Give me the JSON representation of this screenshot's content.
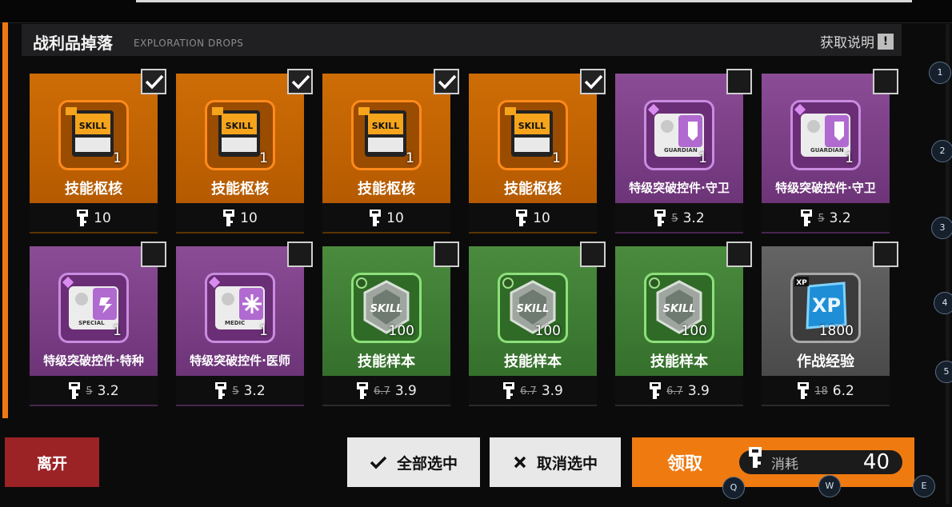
{
  "header": {
    "title": "战利品掉落",
    "subtitle": "EXPLORATION DROPS",
    "help_label": "获取说明",
    "help_icon": "!"
  },
  "items": [
    {
      "name": "技能枢核",
      "qty": "1",
      "cost": "10",
      "old_cost": "",
      "rarity": "orange",
      "icon": "skill-core-icon",
      "checked": true
    },
    {
      "name": "技能枢核",
      "qty": "1",
      "cost": "10",
      "old_cost": "",
      "rarity": "orange",
      "icon": "skill-core-icon",
      "checked": true
    },
    {
      "name": "技能枢核",
      "qty": "1",
      "cost": "10",
      "old_cost": "",
      "rarity": "orange",
      "icon": "skill-core-icon",
      "checked": true
    },
    {
      "name": "技能枢核",
      "qty": "1",
      "cost": "10",
      "old_cost": "",
      "rarity": "orange",
      "icon": "skill-core-icon",
      "checked": true
    },
    {
      "name": "特级突破控件·守卫",
      "qty": "1",
      "cost": "3.2",
      "old_cost": "5",
      "rarity": "purple",
      "icon": "guardian-module-icon",
      "checked": false
    },
    {
      "name": "特级突破控件·守卫",
      "qty": "1",
      "cost": "3.2",
      "old_cost": "5",
      "rarity": "purple",
      "icon": "guardian-module-icon",
      "checked": false
    },
    {
      "name": "特级突破控件·特种",
      "qty": "1",
      "cost": "3.2",
      "old_cost": "5",
      "rarity": "purple",
      "icon": "special-module-icon",
      "checked": false
    },
    {
      "name": "特级突破控件·医师",
      "qty": "1",
      "cost": "3.2",
      "old_cost": "5",
      "rarity": "purple",
      "icon": "medic-module-icon",
      "checked": false
    },
    {
      "name": "技能样本",
      "qty": "100",
      "cost": "3.9",
      "old_cost": "6.7",
      "rarity": "green",
      "icon": "skill-sample-icon",
      "checked": false
    },
    {
      "name": "技能样本",
      "qty": "100",
      "cost": "3.9",
      "old_cost": "6.7",
      "rarity": "green",
      "icon": "skill-sample-icon",
      "checked": false
    },
    {
      "name": "技能样本",
      "qty": "100",
      "cost": "3.9",
      "old_cost": "6.7",
      "rarity": "green",
      "icon": "skill-sample-icon",
      "checked": false
    },
    {
      "name": "作战经验",
      "qty": "1800",
      "cost": "6.2",
      "old_cost": "18",
      "rarity": "gray",
      "icon": "xp-crystal-icon",
      "checked": false
    }
  ],
  "icon_texts": {
    "skill": "SKILL",
    "guardian": "GUARDIAN",
    "special": "SPECIAL",
    "medic": "MEDIC",
    "xp": "XP"
  },
  "buttons": {
    "leave": "离开",
    "select_all": "全部选中",
    "deselect": "取消选中",
    "claim": "领取",
    "cost_label": "消耗",
    "cost_value": "40"
  },
  "hotkeys": [
    "Q",
    "W",
    "E"
  ],
  "side_markers": [
    "1",
    "2",
    "3",
    "4",
    "5"
  ],
  "colors": {
    "accent": "#ef7a10",
    "leave": "#9b2225",
    "orange_card": "#c86806",
    "purple_card": "#7b3f86",
    "green_card": "#3f7d35",
    "gray_card": "#585858"
  }
}
